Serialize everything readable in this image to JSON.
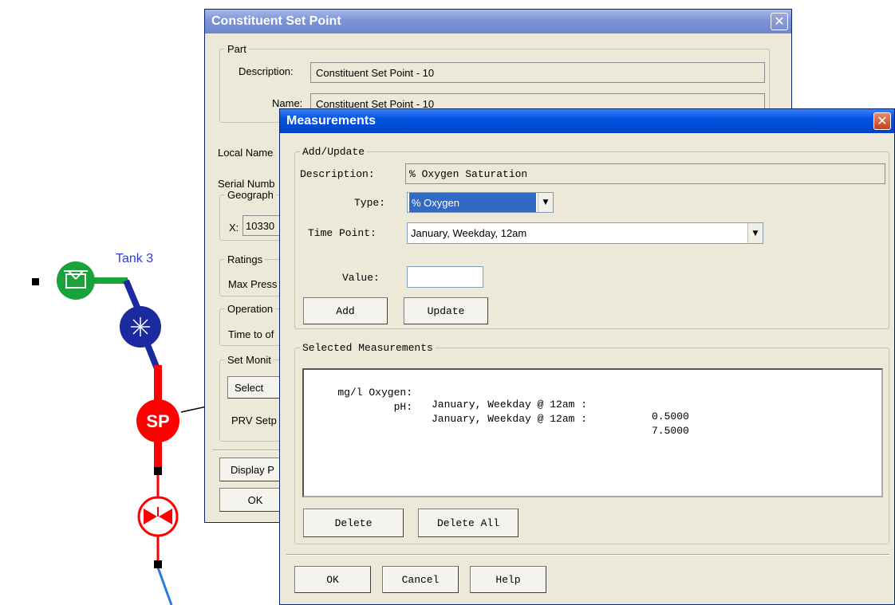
{
  "diagram": {
    "tank_label": "Tank 3",
    "sp_label": "SP"
  },
  "set_point_window": {
    "title": "Constituent Set Point",
    "part_group": "Part",
    "description_label": "Description:",
    "description_value": "Constituent Set Point - 10",
    "name_label": "Name:",
    "name_value": "Constituent Set Point - 10",
    "local_name_label": "Local Name",
    "serial_number_label": "Serial Numb",
    "geographic_group": "Geograph",
    "x_label": "X:",
    "x_value": "10330",
    "ratings_group": "Ratings",
    "max_pressure_label": "Max Press",
    "operation_group": "Operation",
    "time_to_label": "Time to of",
    "set_monitor_group": "Set Monit",
    "select_button": "Select",
    "prv_setpoint_label": "PRV Setp",
    "display_button": "Display P",
    "ok_button": "OK"
  },
  "measurements_window": {
    "title": "Measurements",
    "add_update_group": "Add/Update",
    "description_label": "Description:",
    "description_value": "% Oxygen Saturation",
    "type_label": "Type:",
    "type_value": "% Oxygen",
    "time_point_label": "Time Point:",
    "time_point_value": "January, Weekday, 12am",
    "value_label": "Value:",
    "value_value": "",
    "add_button": "Add",
    "update_button": "Update",
    "selected_group": "Selected Measurements",
    "rows": [
      {
        "name": "mg/l Oxygen:",
        "time": "January, Weekday @ 12am :",
        "value": "0.5000"
      },
      {
        "name": "pH:",
        "time": "January, Weekday @ 12am :",
        "value": "7.5000"
      }
    ],
    "delete_button": "Delete",
    "delete_all_button": "Delete All",
    "ok_button": "OK",
    "cancel_button": "Cancel",
    "help_button": "Help"
  },
  "colors": {
    "tank": "#1aa33a",
    "pump": "#1c2aa0",
    "pipe_red": "#ff0000",
    "pipe_blue": "#1c2aa0",
    "titlebar_active": "#0054e3"
  }
}
